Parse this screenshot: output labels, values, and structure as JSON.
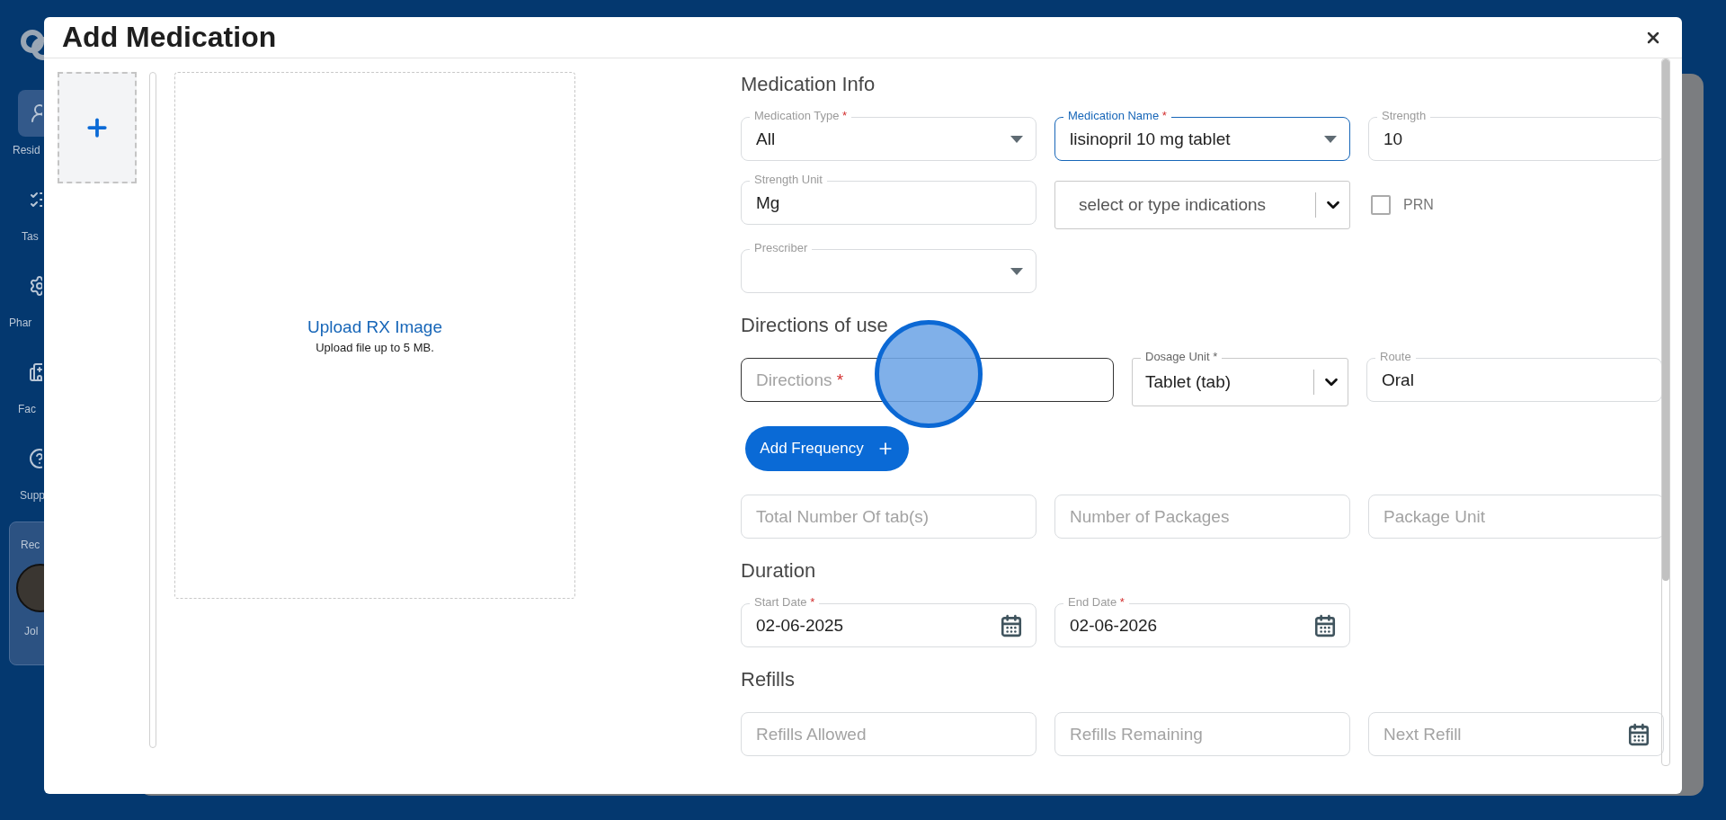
{
  "sidebar": {
    "items": [
      {
        "label": "Resid",
        "selected": true
      },
      {
        "label": "Tas",
        "selected": false
      },
      {
        "label": "Phar",
        "selected": false
      },
      {
        "label": "Fac",
        "selected": false
      },
      {
        "label": "Supp",
        "selected": false
      }
    ],
    "recent": {
      "title": "Rec",
      "name": "Jol"
    }
  },
  "modal": {
    "title": "Add Medication",
    "upload": {
      "link": "Upload RX Image",
      "note": "Upload file up to 5 MB."
    },
    "sections": [
      {
        "heading": "Medication Info",
        "rows": [
          {
            "kind": "thirds",
            "fields": [
              {
                "kind": "select",
                "label": "Medication Type",
                "required_mark": "*",
                "value": "All",
                "focused": false
              },
              {
                "kind": "select",
                "label": "Medication Name",
                "required_mark": "*",
                "value": "lisinopril 10 mg tablet",
                "focused": true
              },
              {
                "kind": "text",
                "label": "Strength",
                "value": "10",
                "focused": false
              }
            ]
          },
          {
            "kind": "thirds",
            "fields": [
              {
                "kind": "text",
                "label": "Strength Unit",
                "value": "Mg",
                "focused": false
              },
              {
                "kind": "combo",
                "placeholder": "select or type indications"
              },
              {
                "kind": "checkbox",
                "label": "PRN",
                "checked": false
              }
            ]
          },
          {
            "kind": "thirds",
            "fields": [
              {
                "kind": "select",
                "label": "Prescriber",
                "focused": false
              }
            ]
          }
        ]
      },
      {
        "heading": "Directions of use",
        "rows": [
          {
            "kind": "wide_first",
            "fields": [
              {
                "kind": "text",
                "placeholder": "Directions",
                "required_mark": "*",
                "focused": true
              },
              {
                "kind": "combo",
                "label": "Dosage Unit *",
                "value": "Tablet (tab)"
              },
              {
                "kind": "text",
                "label": "Route",
                "value": "Oral",
                "focused": false
              }
            ]
          },
          {
            "kind": "thirds",
            "fields": [
              {
                "kind": "button",
                "label": "Add Frequency"
              }
            ]
          },
          {
            "kind": "thirds",
            "fields": [
              {
                "kind": "text",
                "placeholder": "Total Number Of tab(s)",
                "focused": false
              },
              {
                "kind": "text",
                "placeholder": "Number of Packages",
                "focused": false
              },
              {
                "kind": "text",
                "placeholder": "Package Unit",
                "focused": false
              }
            ]
          }
        ]
      },
      {
        "heading": "Duration",
        "rows": [
          {
            "kind": "thirds",
            "fields": [
              {
                "kind": "date",
                "label": "Start Date",
                "required_mark": "*",
                "value": "02-06-2025",
                "focused": false
              },
              {
                "kind": "date",
                "label": "End Date",
                "required_mark": "*",
                "value": "02-06-2026",
                "focused": false
              }
            ]
          }
        ]
      },
      {
        "heading": "Refills",
        "rows": [
          {
            "kind": "thirds",
            "fields": [
              {
                "kind": "text",
                "placeholder": "Refills Allowed",
                "focused": false
              },
              {
                "kind": "text",
                "placeholder": "Refills Remaining",
                "focused": false
              },
              {
                "kind": "date",
                "placeholder": "Next Refill",
                "focused": false
              }
            ]
          }
        ]
      }
    ]
  }
}
